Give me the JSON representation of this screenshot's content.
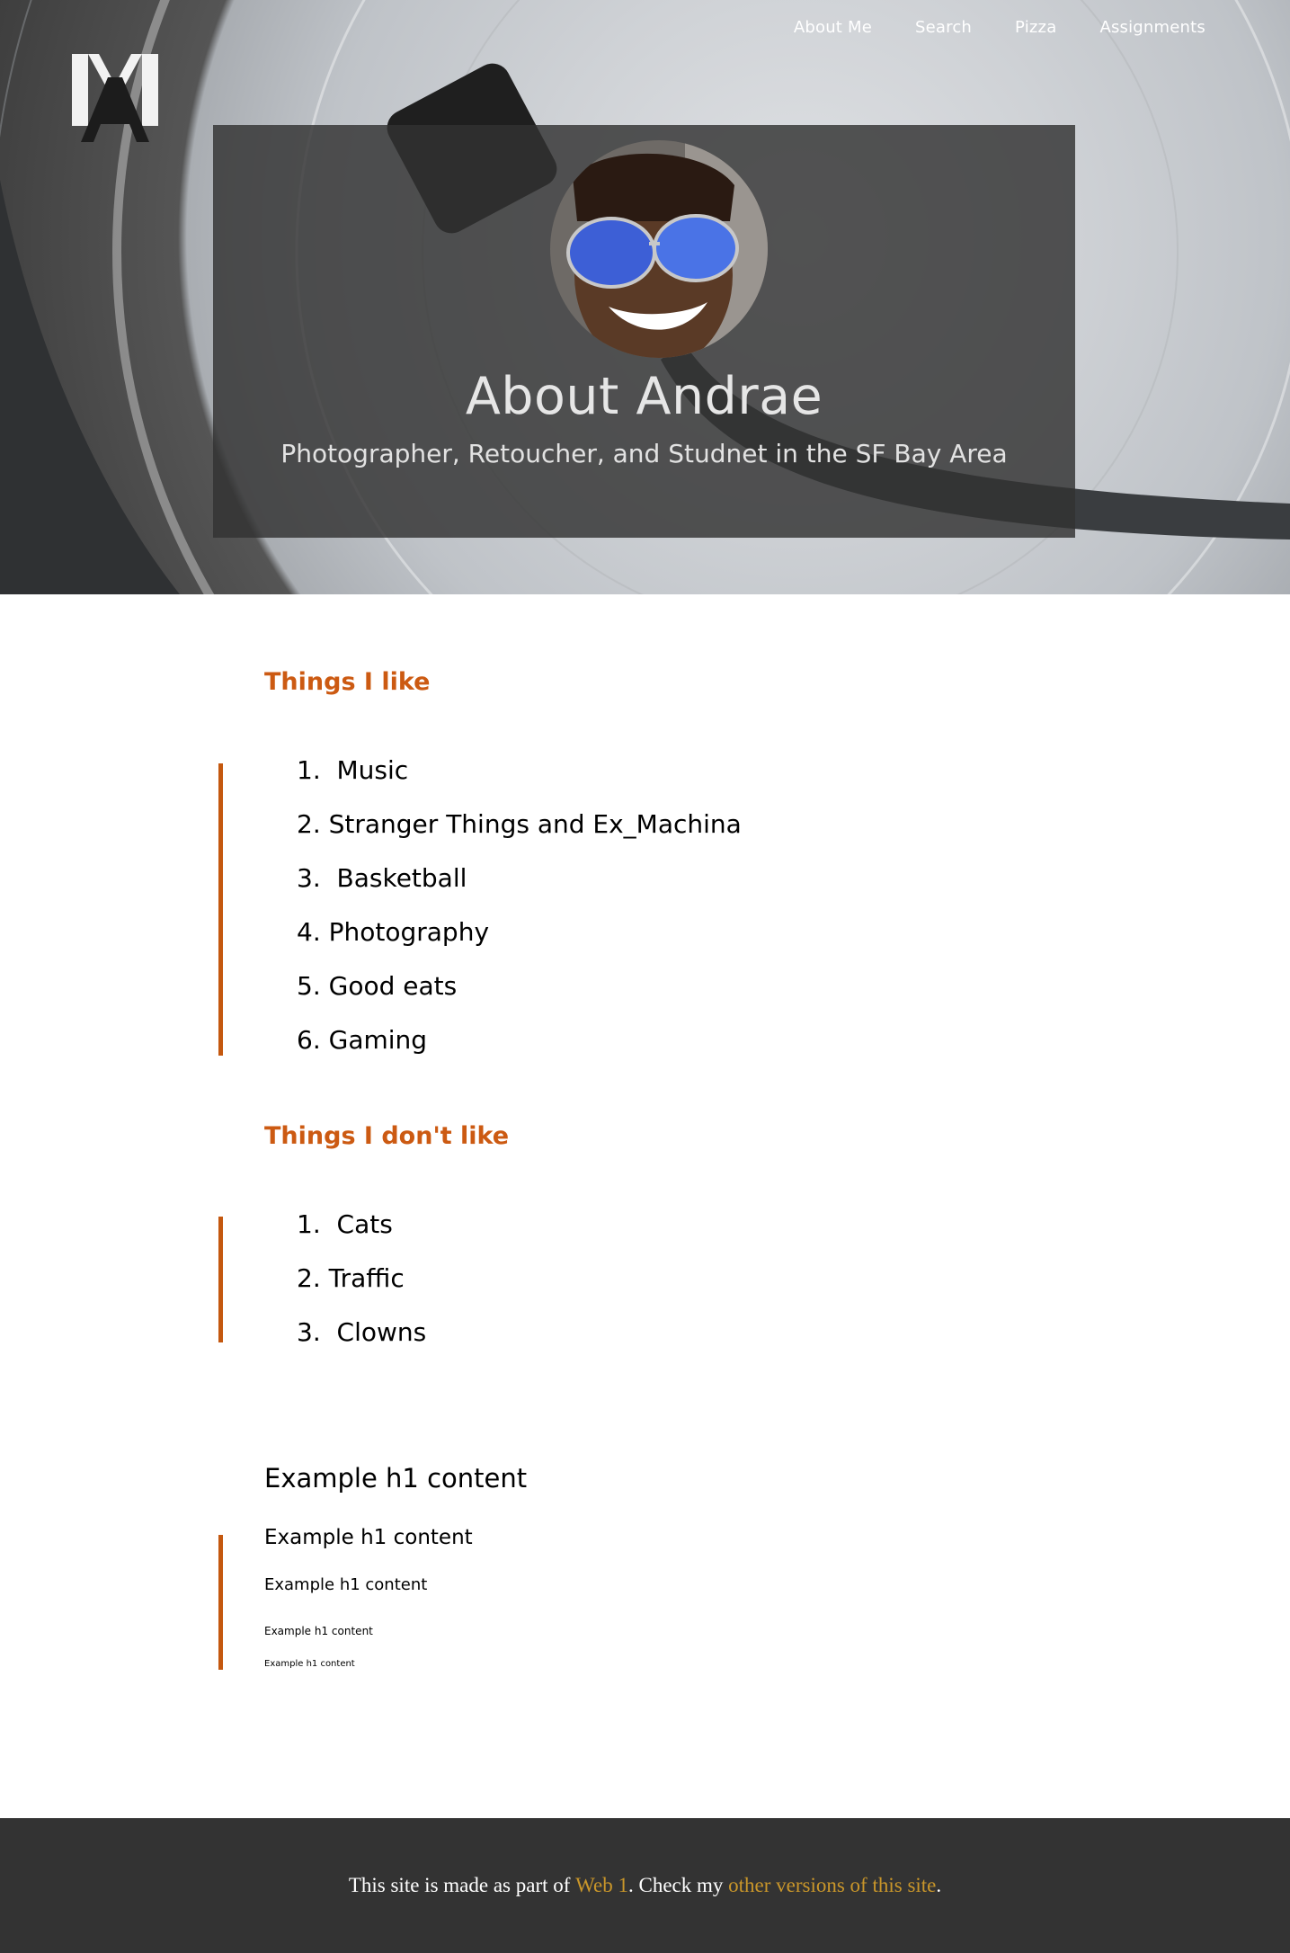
{
  "nav": {
    "items": [
      {
        "label": "About Me"
      },
      {
        "label": "Search"
      },
      {
        "label": "Pizza"
      },
      {
        "label": "Assignments"
      }
    ]
  },
  "hero": {
    "title": "About Andrae",
    "subtitle": "Photographer, Retoucher, and Studnet in the SF Bay Area"
  },
  "likes": {
    "heading": "Things I like",
    "items": [
      "1.  Music",
      "2. Stranger Things and Ex_Machina",
      "3.  Basketball",
      "4. Photography",
      "5. Good eats",
      "6. Gaming"
    ]
  },
  "dislikes": {
    "heading": "Things I don't like",
    "items": [
      "1.  Cats",
      "2. Traffic",
      "3.  Clowns"
    ]
  },
  "examples": {
    "h1": "Example h1 content",
    "h2": "Example h1 content",
    "h3": "Example h1 content",
    "h4": "Example h1 content",
    "h5": "Example h1 content"
  },
  "footer": {
    "prefix": "This site is made as part of ",
    "link1": "Web 1",
    "middle": ". Check my ",
    "link2": "other versions of this site",
    "suffix": "."
  },
  "colors": {
    "accent": "#cc5a12",
    "footer_bg": "#333333",
    "footer_link": "#c9962a"
  }
}
